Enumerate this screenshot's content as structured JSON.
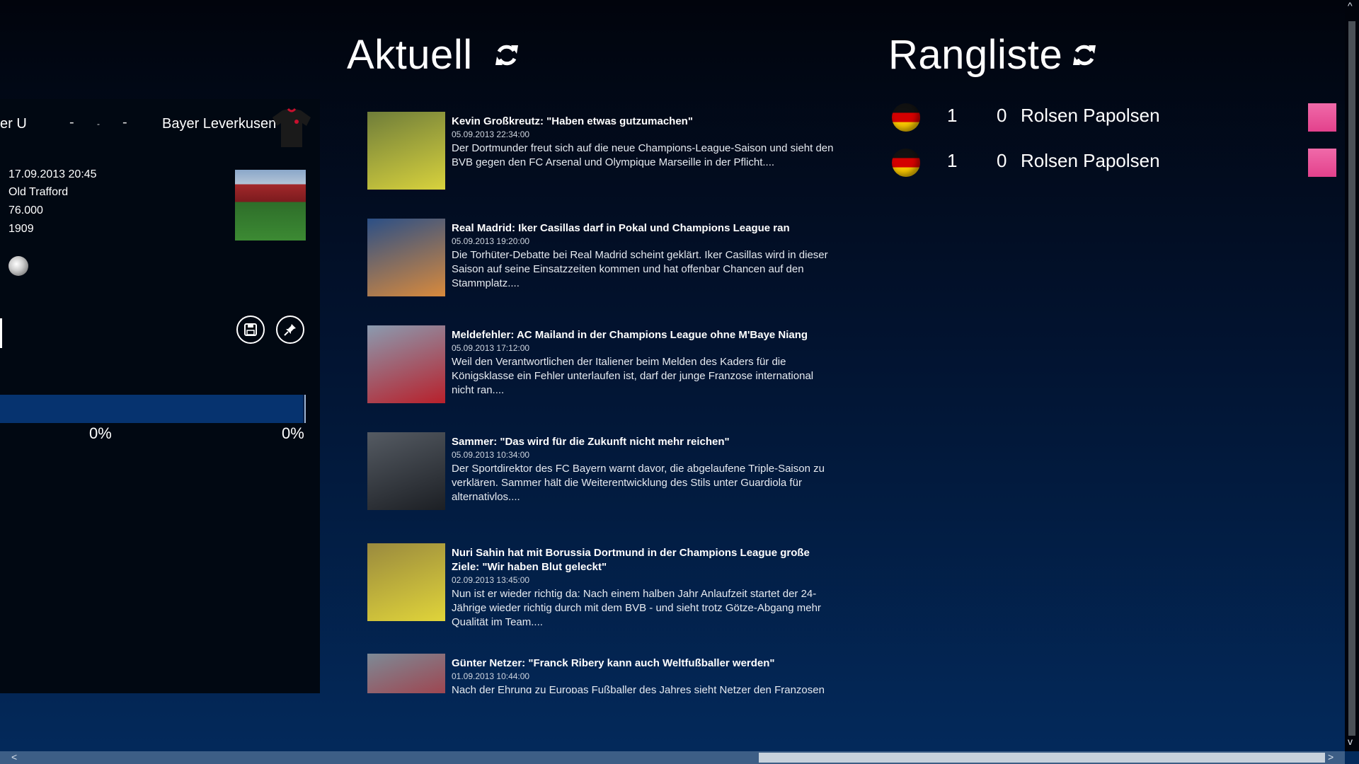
{
  "match": {
    "home_team": "er U",
    "score_dashes": [
      "-",
      "-",
      "-"
    ],
    "away_team": "Bayer Leverkusen",
    "date_time": "17.09.2013 20:45",
    "stadium": "Old Trafford",
    "capacity": "76.000",
    "year": "1909",
    "home_pct": "0%",
    "away_pct": "0%",
    "progress": 0.99,
    "icons": {
      "save": "save-icon",
      "pin": "pin-icon",
      "ball": "soccer-ball-icon"
    }
  },
  "aktuell": {
    "title": "Aktuell",
    "news": [
      {
        "title": "Kevin Großkreutz: \"Haben etwas gutzumachen\"",
        "date": "05.09.2013 22:34:00",
        "desc": "Der Dortmunder freut sich auf die neue Champions-League-Saison und sieht den BVB gegen den FC Arsenal und Olympique Marseille in der Pflicht....",
        "thumb_colors": [
          "#6f7d3a",
          "#d8d23d"
        ]
      },
      {
        "title": "Real Madrid: Iker Casillas darf in Pokal und Champions League ran",
        "date": "05.09.2013 19:20:00",
        "desc": "Die Torhüter-Debatte bei Real Madrid scheint geklärt. Iker Casillas wird in dieser Saison auf seine Einsatzzeiten kommen und hat offenbar Chancen auf den Stammplatz....",
        "thumb_colors": [
          "#2b4f86",
          "#d98a3c"
        ]
      },
      {
        "title": "Meldefehler: AC Mailand in der Champions League ohne M'Baye Niang",
        "date": "05.09.2013 17:12:00",
        "desc": "Weil den Verantwortlichen der Italiener beim Melden des Kaders für die Königsklasse ein Fehler unterlaufen ist, darf der junge Franzose international nicht ran....",
        "thumb_colors": [
          "#8a9bb0",
          "#b8202b"
        ]
      },
      {
        "title": "Sammer: \"Das wird für die Zukunft nicht mehr reichen\"",
        "date": "05.09.2013 10:34:00",
        "desc": "Der Sportdirektor des FC Bayern warnt davor, die abgelaufene Triple-Saison zu verklären. Sammer hält die Weiterentwicklung des Stils unter Guardiola für alternativlos....",
        "thumb_colors": [
          "#555b63",
          "#1c1f24"
        ]
      },
      {
        "title": "Nuri Sahin hat mit Borussia Dortmund in der Champions League große Ziele: \"Wir haben Blut geleckt\"",
        "date": "02.09.2013 13:45:00",
        "desc": "Nun ist er wieder richtig da: Nach einem halben Jahr Anlaufzeit startet der 24-Jährige wieder richtig durch mit dem BVB - und sieht trotz Götze-Abgang mehr Qualität im Team....",
        "thumb_colors": [
          "#9a8a3e",
          "#e0d43a"
        ]
      },
      {
        "title": "Günter Netzer: \"Franck Ribery kann auch Weltfußballer werden\"",
        "date": "01.09.2013 10:44:00",
        "desc": "Nach der Ehrung zu Europas Fußballer des Jahres sieht Netzer den Franzosen Franck",
        "thumb_colors": [
          "#7d8a96",
          "#b0202a"
        ]
      }
    ]
  },
  "rangliste": {
    "title": "Rangliste",
    "rows": [
      {
        "rank": "1",
        "points": "0",
        "name": "Rolsen Papolsen"
      },
      {
        "rank": "1",
        "points": "0",
        "name": "Rolsen Papolsen"
      }
    ]
  },
  "scroll": {
    "left_arrow": "<",
    "right_arrow": ">",
    "up_arrow": "^",
    "down_arrow": "v"
  }
}
